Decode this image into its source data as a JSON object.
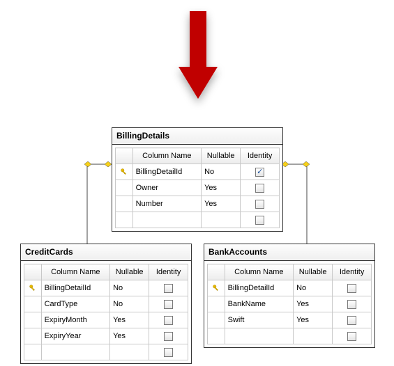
{
  "headers": {
    "column_name": "Column Name",
    "nullable": "Nullable",
    "identity": "Identity"
  },
  "entities": {
    "billing": {
      "title": "BillingDetails",
      "rows": [
        {
          "pk": true,
          "name": "BillingDetailId",
          "nullable": "No",
          "identity_checked": true
        },
        {
          "pk": false,
          "name": "Owner",
          "nullable": "Yes",
          "identity_checked": false
        },
        {
          "pk": false,
          "name": "Number",
          "nullable": "Yes",
          "identity_checked": false
        },
        {
          "pk": false,
          "name": "",
          "nullable": "",
          "identity_checked": false
        }
      ]
    },
    "credit": {
      "title": "CreditCards",
      "rows": [
        {
          "pk": true,
          "name": "BillingDetailId",
          "nullable": "No",
          "identity_checked": false
        },
        {
          "pk": false,
          "name": "CardType",
          "nullable": "No",
          "identity_checked": false
        },
        {
          "pk": false,
          "name": "ExpiryMonth",
          "nullable": "Yes",
          "identity_checked": false
        },
        {
          "pk": false,
          "name": "ExpiryYear",
          "nullable": "Yes",
          "identity_checked": false
        },
        {
          "pk": false,
          "name": "",
          "nullable": "",
          "identity_checked": false
        }
      ]
    },
    "bank": {
      "title": "BankAccounts",
      "rows": [
        {
          "pk": true,
          "name": "BillingDetailId",
          "nullable": "No",
          "identity_checked": false
        },
        {
          "pk": false,
          "name": "BankName",
          "nullable": "Yes",
          "identity_checked": false
        },
        {
          "pk": false,
          "name": "Swift",
          "nullable": "Yes",
          "identity_checked": false
        },
        {
          "pk": false,
          "name": "",
          "nullable": "",
          "identity_checked": false
        }
      ]
    }
  },
  "arrow_color": "#c00000"
}
